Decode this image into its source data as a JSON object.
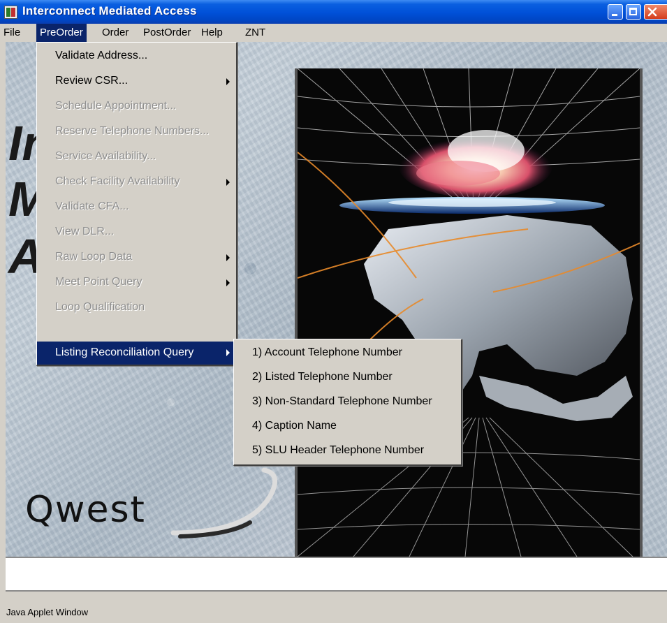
{
  "window": {
    "title": "Interconnect Mediated Access",
    "icon": "app-icon",
    "controls": [
      "minimize-icon",
      "maximize-icon",
      "close-icon"
    ]
  },
  "menubar": {
    "items": [
      {
        "label": "File"
      },
      {
        "label": "PreOrder",
        "active": true
      },
      {
        "label": "Order"
      },
      {
        "label": "PostOrder"
      },
      {
        "label": "Help"
      },
      {
        "label": "ZNT"
      }
    ]
  },
  "preorder_menu": {
    "items": [
      {
        "label": "Validate Address...",
        "enabled": true
      },
      {
        "label": "Review CSR...",
        "enabled": true,
        "submenu": true
      },
      {
        "label": "Schedule Appointment...",
        "enabled": false
      },
      {
        "label": "Reserve Telephone Numbers...",
        "enabled": false
      },
      {
        "label": "Service Availability...",
        "enabled": false
      },
      {
        "label": "Check Facility Availability",
        "enabled": false,
        "submenu": true
      },
      {
        "label": "Validate CFA...",
        "enabled": false
      },
      {
        "label": "View DLR...",
        "enabled": false
      },
      {
        "label": "Raw Loop Data",
        "enabled": false,
        "submenu": true
      },
      {
        "label": "Meet Point Query",
        "enabled": false,
        "submenu": true
      },
      {
        "label": "Loop Qualification",
        "enabled": false
      },
      {
        "label": "Listing Reconciliation Query",
        "enabled": true,
        "submenu": true,
        "selected": true
      }
    ]
  },
  "listing_submenu": {
    "items": [
      {
        "label": "1) Account Telephone Number"
      },
      {
        "label": "2) Listed Telephone Number"
      },
      {
        "label": "3) Non-Standard Telephone Number"
      },
      {
        "label": "4) Caption Name"
      },
      {
        "label": "5) SLU Header Telephone Number"
      }
    ]
  },
  "splash": {
    "logo_text": "Qwest",
    "partial_letters": [
      "In",
      "M",
      "A"
    ]
  },
  "status": {
    "text": "Java Applet Window"
  },
  "colors": {
    "titlebar": "#0050d8",
    "menu_highlight": "#0a246a",
    "menu_bg": "#d4d0c8",
    "disabled_text": "#8e8e8e"
  }
}
